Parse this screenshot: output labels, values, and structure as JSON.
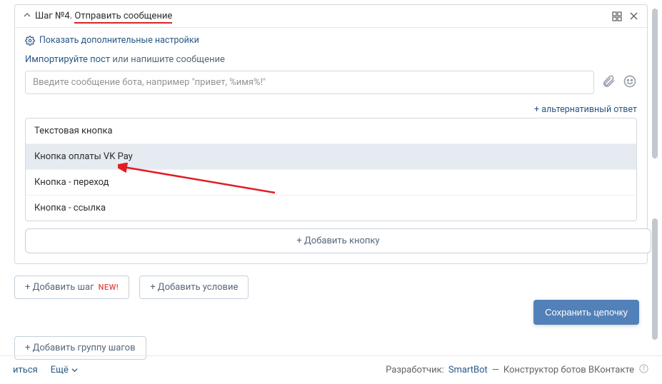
{
  "step": {
    "prefix": "Шаг №4.",
    "title": "Отправить сообщение"
  },
  "advanced_toggle": "Показать дополнительные настройки",
  "import_row": {
    "link": "Импортируйте пост",
    "rest": " или напишите сообщение"
  },
  "message_placeholder": "Введите сообщение бота, например \"привет, %имя%!\"",
  "alt_answer": "+ альтернативный ответ",
  "dropdown": {
    "items": [
      "Текстовая кнопка",
      "Кнопка оплаты VK Pay",
      "Кнопка - переход",
      "Кнопка - ссылка"
    ],
    "highlighted_index": 1
  },
  "add_button": "+ Добавить кнопку",
  "below": {
    "add_step": "+ Добавить шаг",
    "add_step_badge": "NEW!",
    "add_condition": "+ Добавить условие"
  },
  "save_chain": "Сохранить цепочку",
  "add_group": "+ Добавить группу шагов",
  "footer": {
    "left1": "иться",
    "left2": "Ещё",
    "developer_label": "Разработчик:",
    "developer_name": "SmartBot",
    "dash": " — ",
    "tagline": "Конструктор ботов ВКонтакте"
  }
}
